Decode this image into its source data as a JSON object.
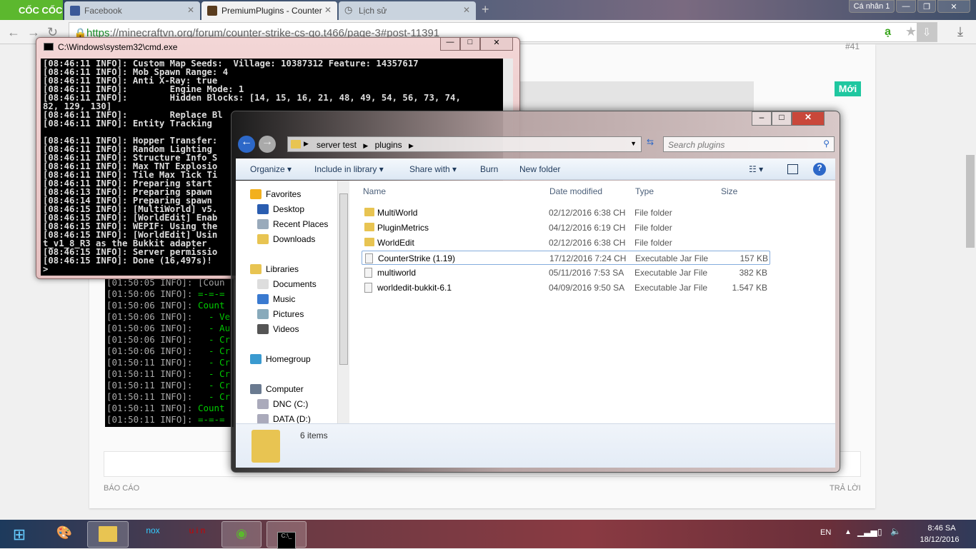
{
  "browser": {
    "logo": "CỐC CỐC",
    "tabs": [
      {
        "label": "Facebook",
        "icon": "facebook-icon"
      },
      {
        "label": "PremiumPlugins - Counter",
        "icon": "minecraft-icon",
        "active": true
      },
      {
        "label": "Lịch sử",
        "icon": "history-icon"
      }
    ],
    "profile": "Cá nhân 1",
    "url_scheme": "https",
    "url_rest": "://minecraftvn.org/forum/counter-strike-cs-go.t466/page-3#post-11391",
    "accent": "#5cb82e"
  },
  "page": {
    "post_number": "#41",
    "badge": "Mới",
    "report": "BÁO CÁO",
    "reply": "TRẢ LỜI",
    "badge_color": "#1fc7a0"
  },
  "bg_console": {
    "lines": [
      [
        "[01:50:05 INFO]: ",
        "[Coun",
        false
      ],
      [
        "[01:50:06 INFO]: ",
        "=-=-=",
        true
      ],
      [
        "[01:50:06 INFO]: ",
        "Count",
        true
      ],
      [
        "[01:50:06 INFO]: ",
        "  - Ve",
        true
      ],
      [
        "[01:50:06 INFO]: ",
        "  - Au",
        true
      ],
      [
        "[01:50:06 INFO]: ",
        "  - Cr",
        true
      ],
      [
        "[01:50:06 INFO]: ",
        "  - Cr",
        true
      ],
      [
        "[01:50:11 INFO]: ",
        "  - Cr",
        true
      ],
      [
        "[01:50:11 INFO]: ",
        "  - Cr",
        true
      ],
      [
        "[01:50:11 INFO]: ",
        "  - Cr",
        true
      ],
      [
        "[01:50:11 INFO]: ",
        "  - Cr",
        true
      ],
      [
        "[01:50:11 INFO]: ",
        "Count",
        true
      ],
      [
        "[01:50:11 INFO]: ",
        "=-=-=",
        true
      ]
    ]
  },
  "cmd": {
    "title": "C:\\Windows\\system32\\cmd.exe",
    "lines": [
      "[08:46:11 INFO]: Custom Map Seeds:  Village: 10387312 Feature: 14357617",
      "[08:46:11 INFO]: Mob Spawn Range: 4",
      "[08:46:11 INFO]: Anti X-Ray: true",
      "[08:46:11 INFO]:        Engine Mode: 1",
      "[08:46:11 INFO]:        Hidden Blocks: [14, 15, 16, 21, 48, 49, 54, 56, 73, 74,",
      "82, 129, 130]",
      "[08:46:11 INFO]:        Replace Bl",
      "[08:46:11 INFO]: Entity Tracking",
      "",
      "[08:46:11 INFO]: Hopper Transfer:",
      "[08:46:11 INFO]: Random Lighting",
      "[08:46:11 INFO]: Structure Info S",
      "[08:46:11 INFO]: Max TNT Explosio",
      "[08:46:11 INFO]: Tile Max Tick Ti",
      "[08:46:11 INFO]: Preparing start",
      "[08:46:13 INFO]: Preparing spawn",
      "[08:46:14 INFO]: Preparing spawn",
      "[08:46:15 INFO]: [MultiWorld] v5.",
      "[08:46:15 INFO]: [WorldEdit] Enab",
      "[08:46:15 INFO]: WEPIF: Using the",
      "[08:46:15 INFO]: [WorldEdit] Usin",
      "t_v1_8_R3 as the Bukkit adapter",
      "[08:46:15 INFO]: Server permissio",
      "[08:46:15 INFO]: Done (16,497s)!",
      ">"
    ]
  },
  "explorer": {
    "breadcrumb": [
      "server test",
      "plugins"
    ],
    "search_placeholder": "Search plugins",
    "toolbar": [
      "Organize ▾",
      "Include in library ▾",
      "Share with ▾",
      "Burn",
      "New folder"
    ],
    "nav": [
      {
        "label": "Favorites",
        "icon": "star-icon",
        "head": true
      },
      {
        "label": "Desktop",
        "icon": "desktop-icon"
      },
      {
        "label": "Recent Places",
        "icon": "recent-places-icon"
      },
      {
        "label": "Downloads",
        "icon": "downloads-icon"
      },
      {
        "label": "Libraries",
        "icon": "libraries-icon",
        "head": true
      },
      {
        "label": "Documents",
        "icon": "documents-icon"
      },
      {
        "label": "Music",
        "icon": "music-icon"
      },
      {
        "label": "Pictures",
        "icon": "pictures-icon"
      },
      {
        "label": "Videos",
        "icon": "videos-icon"
      },
      {
        "label": "Homegroup",
        "icon": "homegroup-icon",
        "head": true
      },
      {
        "label": "Computer",
        "icon": "computer-icon",
        "head": true
      },
      {
        "label": "DNC (C:)",
        "icon": "drive-icon"
      },
      {
        "label": "DATA (D:)",
        "icon": "drive-icon"
      }
    ],
    "columns": [
      "Name",
      "Date modified",
      "Type",
      "Size"
    ],
    "files": [
      {
        "name": "MultiWorld",
        "date": "02/12/2016 6:38 CH",
        "type": "File folder",
        "size": "",
        "kind": "folder"
      },
      {
        "name": "PluginMetrics",
        "date": "04/12/2016 6:19 CH",
        "type": "File folder",
        "size": "",
        "kind": "folder"
      },
      {
        "name": "WorldEdit",
        "date": "02/12/2016 6:38 CH",
        "type": "File folder",
        "size": "",
        "kind": "folder"
      },
      {
        "name": "CounterStrike (1.19)",
        "date": "17/12/2016 7:24 CH",
        "type": "Executable Jar File",
        "size": "157 KB",
        "kind": "jar",
        "selected": true
      },
      {
        "name": "multiworld",
        "date": "05/11/2016 7:53 SA",
        "type": "Executable Jar File",
        "size": "382 KB",
        "kind": "jar"
      },
      {
        "name": "worldedit-bukkit-6.1",
        "date": "04/09/2016 9:50 SA",
        "type": "Executable Jar File",
        "size": "1.547 KB",
        "kind": "jar"
      }
    ],
    "item_count": "6 items"
  },
  "taskbar": {
    "apps": [
      "start-orb",
      "paint",
      "explorer",
      "nox",
      "unikey",
      "coccoc",
      "cmd"
    ],
    "lang": "EN",
    "time": "8:46 SA",
    "date": "18/12/2016"
  }
}
